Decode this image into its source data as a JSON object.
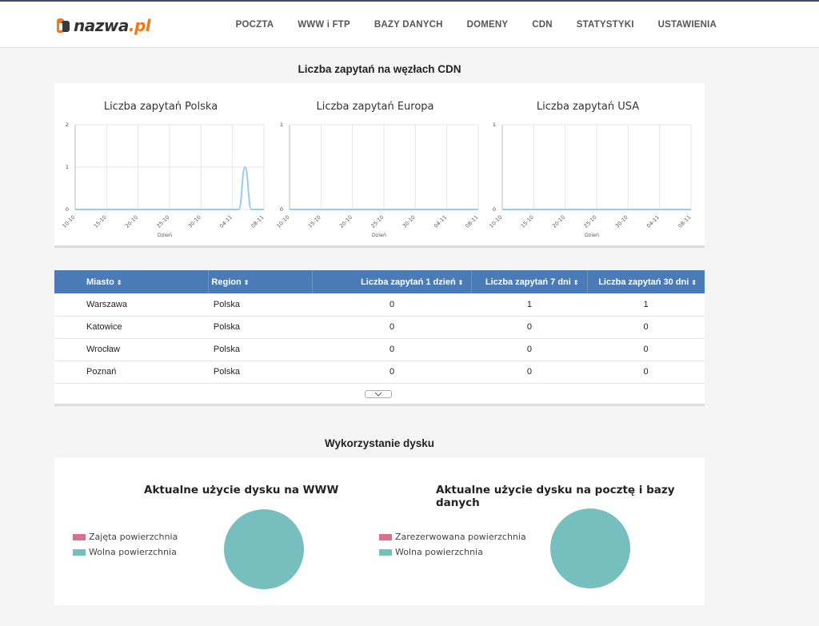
{
  "brand": {
    "logo_main": "nazwa",
    "logo_tld": ".pl"
  },
  "nav": [
    "POCZTA",
    "WWW i FTP",
    "BAZY DANYCH",
    "DOMENY",
    "CDN",
    "STATYSTYKI",
    "USTAWIENIA"
  ],
  "cdn": {
    "section_title": "Liczba zapytań na węzłach CDN",
    "xlabel": "Dzień",
    "x_ticks": [
      "10-10",
      "15-10",
      "20-10",
      "25-10",
      "30-10",
      "04-11",
      "08-11"
    ]
  },
  "chart_data": [
    {
      "type": "line",
      "title": "Liczba zapytań Polska",
      "xlabel": "Dzień",
      "ylabel": "",
      "ylim": [
        0,
        2
      ],
      "y_ticks": [
        "0",
        "1",
        "2"
      ],
      "x_ticks": [
        "10-10",
        "15-10",
        "20-10",
        "25-10",
        "30-10",
        "04-11",
        "08-11"
      ],
      "x": [
        0,
        5,
        10,
        15,
        20,
        25,
        26,
        27,
        28,
        29,
        30
      ],
      "values": [
        0,
        0,
        0,
        0,
        0,
        0,
        0,
        1,
        0,
        0,
        0
      ],
      "color": "#97cdf3",
      "grid": true
    },
    {
      "type": "line",
      "title": "Liczba zapytań Europa",
      "xlabel": "Dzień",
      "ylabel": "",
      "ylim": [
        0,
        1
      ],
      "y_ticks": [
        "0",
        "1"
      ],
      "x_ticks": [
        "10-10",
        "15-10",
        "20-10",
        "25-10",
        "30-10",
        "04-11",
        "08-11"
      ],
      "x": [
        0,
        30
      ],
      "values": [
        0,
        0
      ],
      "color": "#97cdf3",
      "grid": true
    },
    {
      "type": "line",
      "title": "Liczba zapytań USA",
      "xlabel": "Dzień",
      "ylabel": "",
      "ylim": [
        0,
        1
      ],
      "y_ticks": [
        "0",
        "1"
      ],
      "x_ticks": [
        "10-10",
        "15-10",
        "20-10",
        "25-10",
        "30-10",
        "04-11",
        "08-11"
      ],
      "x": [
        0,
        30
      ],
      "values": [
        0,
        0
      ],
      "color": "#97cdf3",
      "grid": true
    }
  ],
  "table": {
    "columns": [
      "Miasto",
      "Region",
      "Liczba zapytań 1 dzień",
      "Liczba zapytań 7 dni",
      "Liczba zapytań 30 dni"
    ],
    "sort_icon": "⇕",
    "rows": [
      [
        "Warszawa",
        "Polska",
        "0",
        "1",
        "1"
      ],
      [
        "Katowice",
        "Polska",
        "0",
        "0",
        "0"
      ],
      [
        "Wrocław",
        "Polska",
        "0",
        "0",
        "0"
      ],
      [
        "Poznań",
        "Polska",
        "0",
        "0",
        "0"
      ]
    ],
    "expand_icon": "chevron-down-icon"
  },
  "disk": {
    "section_title": "Wykorzystanie dysku",
    "www": {
      "title": "Aktualne użycie dysku na WWW",
      "legend": [
        {
          "label": "Zajęta powierzchnia",
          "color": "#d9708a"
        },
        {
          "label": "Wolna powierzchnia",
          "color": "#77bfbf"
        }
      ],
      "used_fraction": 0
    },
    "mail": {
      "title": "Aktualne użycie dysku na pocztę i bazy danych",
      "legend": [
        {
          "label": "Zarezerwowana powierzchnia",
          "color": "#d9708a"
        },
        {
          "label": "Wolna powierzchnia",
          "color": "#77bfbf"
        }
      ],
      "used_fraction": 0
    }
  }
}
